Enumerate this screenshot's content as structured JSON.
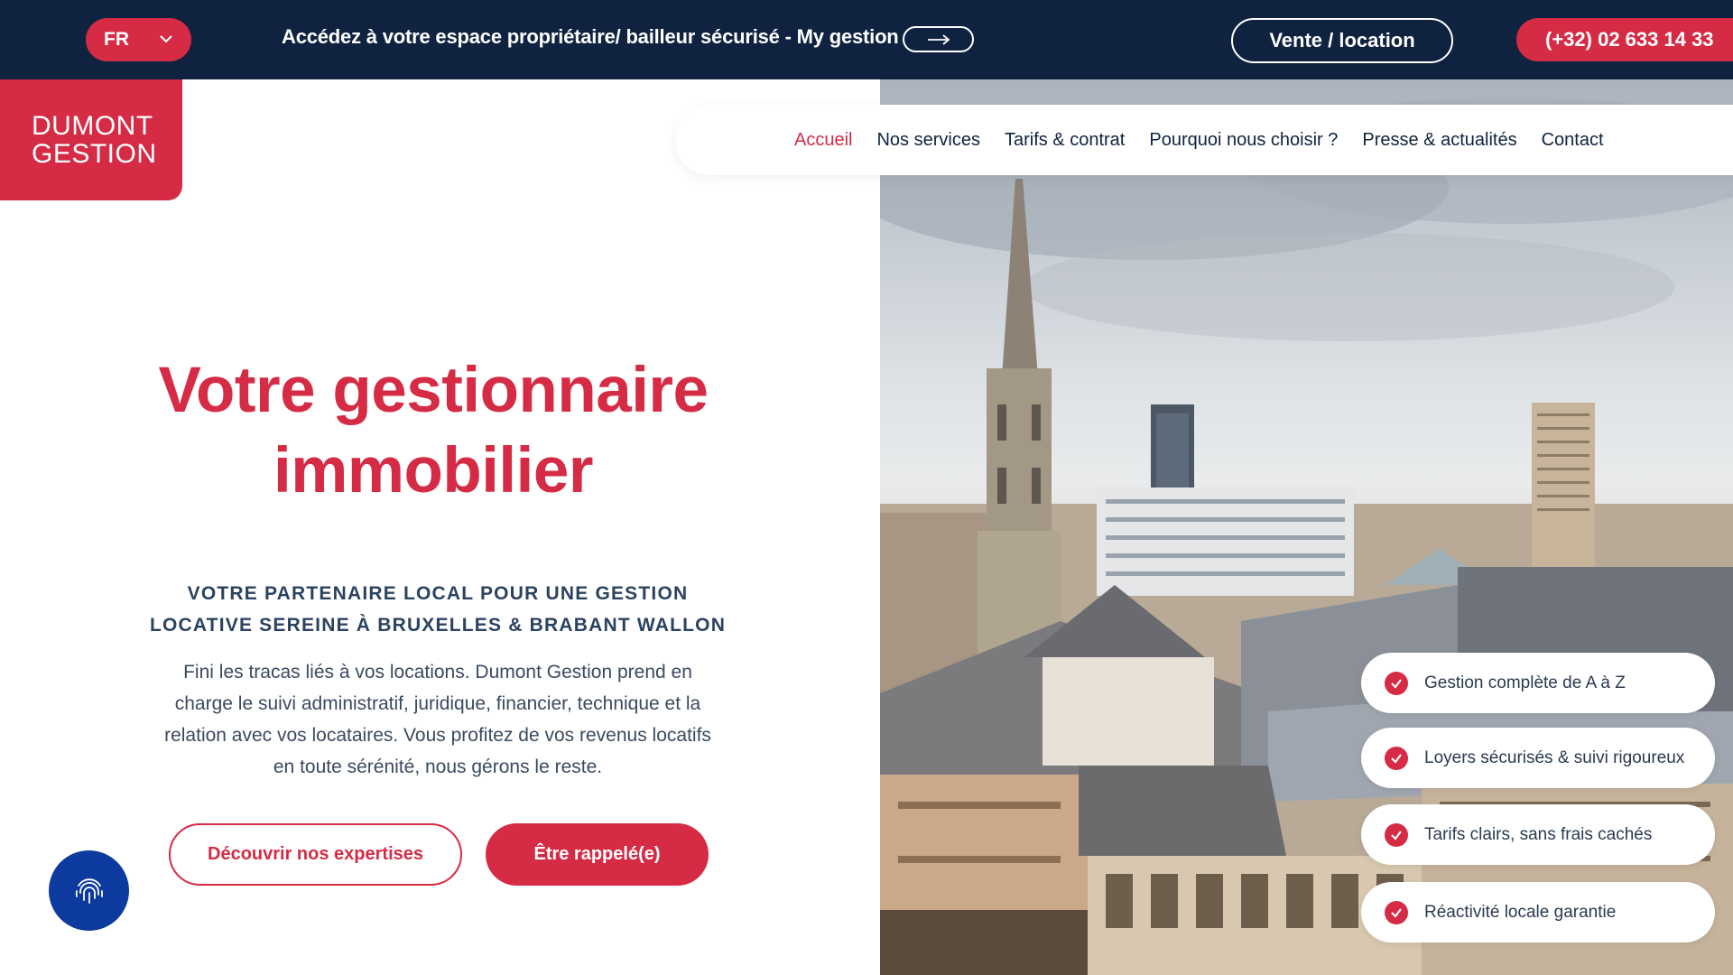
{
  "topbar": {
    "language": "FR",
    "promo_text": "Accédez à votre espace propriétaire/ bailleur sécurisé - My gestion",
    "sale_rent_label": "Vente / location",
    "phone_label": "(+32) 02 633 14 33"
  },
  "logo": {
    "line1": "DUMONT",
    "line2": "GESTION"
  },
  "nav": {
    "items": [
      {
        "label": "Accueil",
        "active": true
      },
      {
        "label": "Nos services"
      },
      {
        "label": "Tarifs & contrat"
      },
      {
        "label": "Pourquoi nous choisir ?"
      },
      {
        "label": "Presse & actualités"
      },
      {
        "label": "Contact"
      }
    ]
  },
  "hero": {
    "title_line1": "Votre gestionnaire",
    "title_line2": "immobilier",
    "kicker_line1": "VOTRE PARTENAIRE LOCAL POUR UNE GESTION",
    "kicker_line2": "LOCATIVE SEREINE À  BRUXELLES & BRABANT WALLON",
    "body": "Fini les tracas liés à vos locations. Dumont Gestion prend en charge le suivi administratif, juridique, financier, technique et la relation avec vos locataires. Vous profitez de vos revenus locatifs en toute sérénité, nous gérons le reste.",
    "cta_secondary": "Découvrir nos expertises",
    "cta_primary": "Être rappelé(e)"
  },
  "features": [
    "Gestion complète de A à Z",
    "Loyers sécurisés & suivi rigoureux",
    "Tarifs clairs, sans frais cachés",
    "Réactivité locale garantie"
  ],
  "colors": {
    "brand_red": "#d52b45",
    "navy": "#0f2340",
    "fingerprint_blue": "#0d3a9e"
  },
  "icons": [
    "chevron-down-icon",
    "arrow-right-icon",
    "check-circle-icon",
    "fingerprint-icon"
  ]
}
